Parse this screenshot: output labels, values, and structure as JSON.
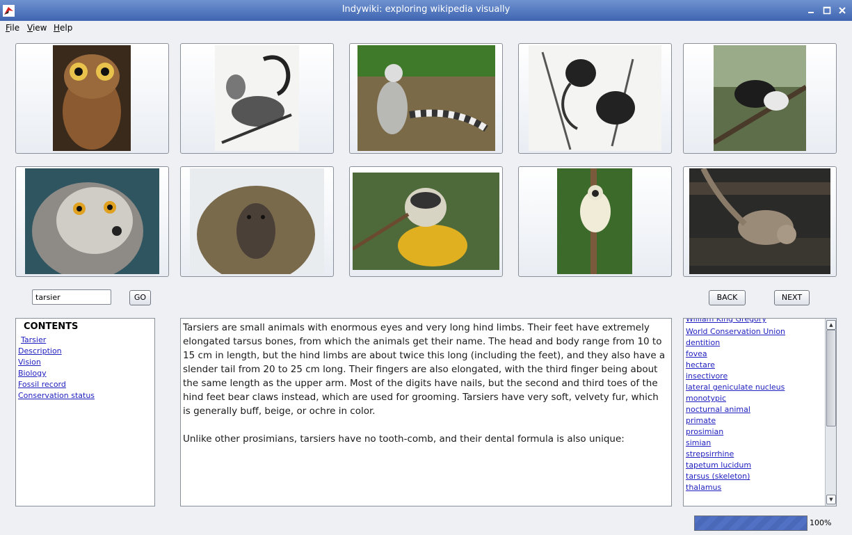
{
  "window": {
    "title": "Indywiki: exploring wikipedia visually"
  },
  "menu": [
    {
      "mnemonic": "F",
      "rest": "ile"
    },
    {
      "mnemonic": "V",
      "rest": "iew"
    },
    {
      "mnemonic": "H",
      "rest": "elp"
    }
  ],
  "search": {
    "value": "tarsier",
    "go_label": "GO"
  },
  "nav": {
    "back_label": "BACK",
    "next_label": "NEXT"
  },
  "contents": {
    "title": "CONTENTS",
    "items": [
      "Tarsier",
      "Description",
      "Vision",
      "Biology",
      "Fossil record",
      "Conservation status"
    ]
  },
  "article": {
    "paragraphs": [
      "Tarsiers are small animals with enormous eyes and very long hind limbs. Their feet have extremely elongated tarsus bones, from which the animals get their name. The head and body range from 10 to 15 cm in length, but the hind limbs are about twice this long (including the feet), and they also have a slender tail from 20 to 25 cm long. Their fingers are also elongated, with the third finger being about the same length as the upper arm. Most of the digits have nails, but the second and third toes of the hind feet bear claws instead, which are used for grooming. Tarsiers have very soft, velvety fur, which is generally buff, beige, or ochre in color.",
      "Unlike other prosimians, tarsiers have no tooth-comb, and their dental formula is also unique:"
    ]
  },
  "related_links": [
    "William King Gregory",
    "World Conservation Union",
    "dentition",
    "fovea",
    "hectare",
    "insectivore",
    "lateral geniculate nucleus",
    "monotypic",
    "nocturnal animal",
    "primate",
    "prosimian",
    "simian",
    "strepsirrhine",
    "tapetum lucidum",
    "tarsus (skeleton)",
    "thalamus"
  ],
  "status": {
    "progress_label": "100%",
    "progress": 1.0
  },
  "icons": {
    "app": "indywiki-icon",
    "minimize": "minimize-icon",
    "maximize": "maximize-icon",
    "close": "close-icon"
  },
  "thumbnails": [
    "tarsier",
    "lemur engraving",
    "ring-tailed lemur",
    "primates engraving",
    "indri",
    "crowned lemur",
    "baboon",
    "squirrel monkey",
    "sifaka",
    "galago"
  ]
}
